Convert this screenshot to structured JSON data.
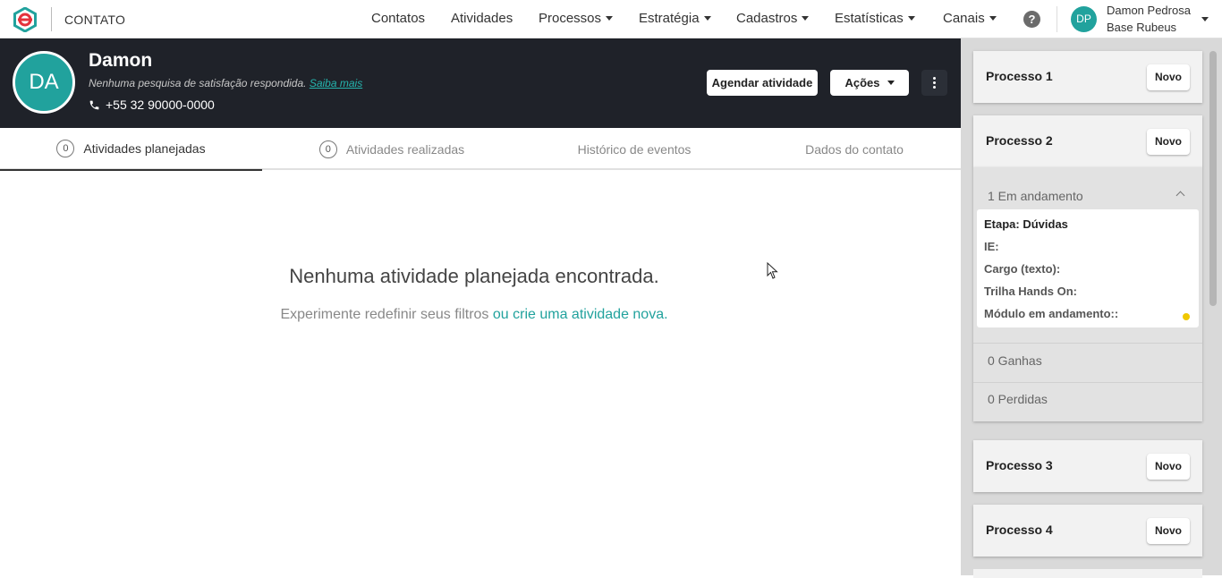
{
  "app": {
    "brand": "CONTATO"
  },
  "nav": {
    "items": [
      {
        "label": "Contatos",
        "has_caret": false
      },
      {
        "label": "Atividades",
        "has_caret": false
      },
      {
        "label": "Processos",
        "has_caret": true
      },
      {
        "label": "Estratégia",
        "has_caret": true
      },
      {
        "label": "Cadastros",
        "has_caret": true
      },
      {
        "label": "Estatísticas",
        "has_caret": true
      },
      {
        "label": "Canais",
        "has_caret": true
      }
    ],
    "help_label": "?"
  },
  "user": {
    "initials": "DP",
    "name": "Damon Pedrosa",
    "base": "Base Rubeus"
  },
  "contact": {
    "initials": "DA",
    "name": "Damon",
    "survey_text": "Nenhuma pesquisa de satisfação respondida. ",
    "survey_link": "Saiba mais",
    "phone": "+55 32 90000-0000"
  },
  "actions": {
    "schedule_label": "Agendar atividade",
    "actions_label": "Ações"
  },
  "tabs": [
    {
      "label": "Atividades planejadas",
      "count": "0",
      "active": true
    },
    {
      "label": "Atividades realizadas",
      "count": "0",
      "active": false
    },
    {
      "label": "Histórico de eventos",
      "active": false
    },
    {
      "label": "Dados do contato",
      "active": false
    }
  ],
  "empty": {
    "title": "Nenhuma atividade planejada encontrada.",
    "subtitle": "Experimente redefinir seus filtros ",
    "link": "ou crie uma atividade nova."
  },
  "processes": {
    "new_label": "Novo",
    "items": [
      {
        "title": "Processo 1"
      },
      {
        "title": "Processo 2"
      },
      {
        "title": "Processo 3"
      },
      {
        "title": "Processo 4"
      }
    ],
    "expanded": {
      "in_progress": "1 Em andamento",
      "deal": {
        "stage": "Etapa: Dúvidas",
        "ie": "IE:",
        "cargo": "Cargo (texto):",
        "trilha": "Trilha Hands On:",
        "modulo": "Módulo em andamento::"
      },
      "won": "0 Ganhas",
      "lost": "0 Perdidas"
    }
  },
  "colors": {
    "accent": "#21a29d",
    "header_dark": "#1f2229",
    "status_yellow": "#f0c800"
  }
}
